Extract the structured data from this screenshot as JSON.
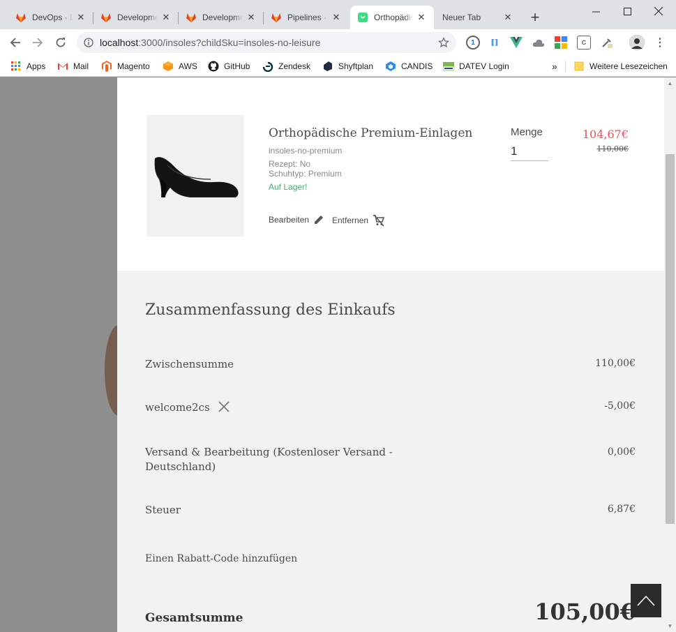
{
  "browser": {
    "tabs": [
      {
        "title": "DevOps · B",
        "icon": "gitlab-icon"
      },
      {
        "title": "Developme",
        "icon": "gitlab-icon"
      },
      {
        "title": "Developme",
        "icon": "gitlab-icon"
      },
      {
        "title": "Pipelines · ",
        "icon": "gitlab-icon"
      },
      {
        "title": "Orthopädis",
        "icon": "shop-icon",
        "active": true
      },
      {
        "title": "Neuer Tab",
        "icon": ""
      }
    ],
    "url_host": "localhost",
    "url_rest": ":3000/insoles?childSku=insoles-no-leisure",
    "bookmarks": [
      {
        "label": "Apps",
        "icon": "apps-grid-icon"
      },
      {
        "label": "Mail",
        "icon": "gmail-icon"
      },
      {
        "label": "Magento",
        "icon": "magento-icon"
      },
      {
        "label": "AWS",
        "icon": "aws-icon"
      },
      {
        "label": "GitHub",
        "icon": "github-icon"
      },
      {
        "label": "Zendesk",
        "icon": "zendesk-icon"
      },
      {
        "label": "Shyftplan",
        "icon": "shyftplan-icon"
      },
      {
        "label": "CANDIS",
        "icon": "candis-icon"
      },
      {
        "label": "DATEV Login",
        "icon": "datev-icon"
      }
    ],
    "bookmarks_more": "»",
    "other_bookmarks": "Weitere Lesezeichen"
  },
  "cart": {
    "product": {
      "name": "Orthopädische Premium-Einlagen",
      "sku": "insoles-no-premium",
      "option1": "Rezept: No",
      "option2": "Schuhtyp: Premium",
      "stock": "Auf Lager!",
      "edit_label": "Bearbeiten",
      "remove_label": "Entfernen",
      "qty_label": "Menge",
      "qty_value": "1",
      "price": "104,67€",
      "old_price": "110,00€"
    },
    "summary": {
      "title": "Zusammenfassung des Einkaufs",
      "subtotal_label": "Zwischensumme",
      "subtotal_value": "110,00€",
      "coupon_label": "welcome2cs",
      "coupon_value": "-5,00€",
      "shipping_label": "Versand & Bearbeitung (Kostenloser Versand - Deutschland)",
      "shipping_value": "0,00€",
      "tax_label": "Steuer",
      "tax_value": "6,87€",
      "discount_link": "Einen Rabatt-Code hinzufügen",
      "total_label": "Gesamtsumme",
      "total_value": "105,00€"
    }
  },
  "colors": {
    "price_red": "#e8505b",
    "stock_green": "#3fb06e",
    "summary_bg": "#f2f2f2",
    "overlay_gray": "#8f8f8f"
  }
}
